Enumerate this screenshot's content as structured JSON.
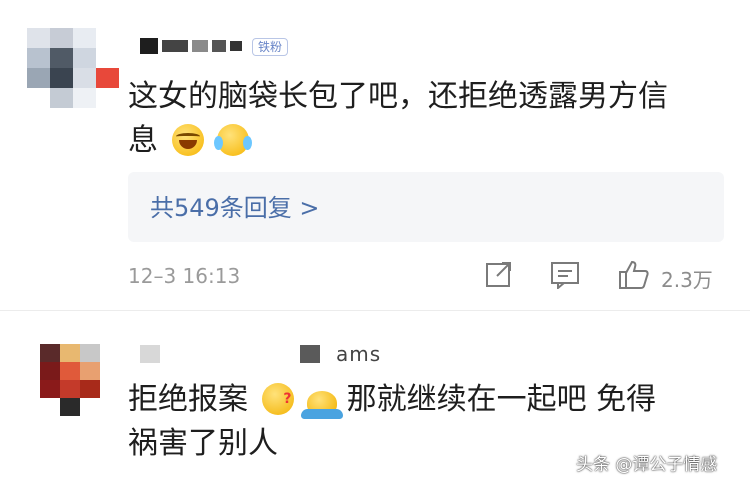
{
  "comment1": {
    "badge": "铁粉",
    "text_line1": "这女的脑袋长包了吧，还拒绝透露男方信",
    "text_line2": "息",
    "emojis": [
      "laughing-crying-icon",
      "crying-icon"
    ],
    "replies_label": "共549条回复 >",
    "timestamp": "12–3 16:13",
    "like_count": "2.3万",
    "actions": [
      "share-icon",
      "comment-icon",
      "like-icon"
    ]
  },
  "comment2": {
    "name_tail": "ams",
    "text_line1": "拒绝报案",
    "text_line1_rest": "那就继续在一起吧 免得",
    "text_line2": "祸害了别人",
    "emojis": [
      "thinking-face-icon",
      "shrug-icon"
    ]
  },
  "watermark": "头条 @谭公子情感",
  "colors": {
    "link": "#4a6ea8",
    "meta": "#9a9a9a",
    "reply_bg": "#f5f6f8",
    "badge": "#6a86c8"
  }
}
